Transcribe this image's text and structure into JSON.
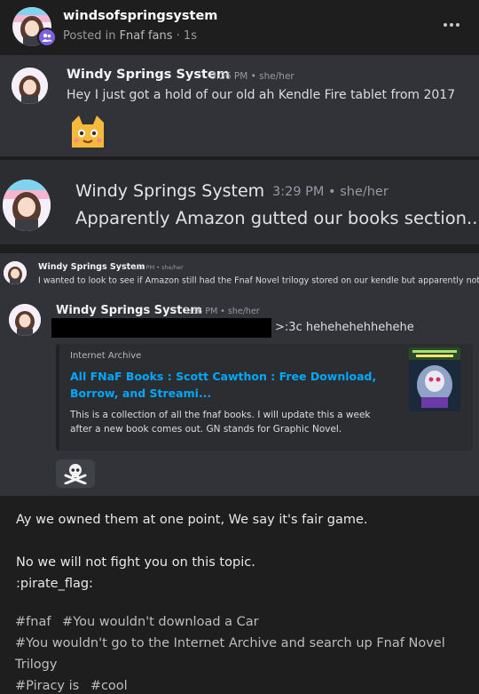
{
  "post": {
    "username": "windsofspringsystem",
    "posted_in_prefix": "Posted in",
    "community": "Fnaf fans",
    "age": "· 1s",
    "more_label": "···"
  },
  "screenshots": [
    {
      "name": "Windy Springs System",
      "time": "3:26 PM • she/her",
      "message": "Hey I just got a hold of our old ah Kendle Fire tablet from 2017"
    },
    {
      "name": "Windy Springs System",
      "time": "3:29 PM • she/her",
      "message": "Apparently Amazon gutted our books section..."
    },
    {
      "name": "Windy Springs System",
      "time": "3:31 PM • she/her",
      "message": "I wanted to look to see if Amazon still had the Fnaf Novel trilogy stored on our kendle but apparently not"
    },
    {
      "name": "Windy Springs System",
      "time": "3:36 PM • she/her",
      "message": ">:3c hehehehehhehehe"
    }
  ],
  "embed": {
    "provider": "Internet Archive",
    "title": "All FNaF Books : Scott Cawthon : Free Download, Borrow, and Streami...",
    "description": "This is a collection of all the fnaf books. I will update this a week after a new book comes out. GN stands for Graphic Novel."
  },
  "caption": {
    "line1": "Ay we owned them at one point, We say it's fair game.",
    "line2": "No we will not fight you on this topic.",
    "line3": ":pirate_flag:"
  },
  "tags": [
    "#fnaf",
    "#You wouldn't download a Car",
    "#You wouldn't go to the Internet Archive and search up Fnaf Novel Trilogy",
    "#Piracy is",
    "#cool"
  ],
  "colors": {
    "background": "#1e1e1e",
    "discord_bg": "#313338",
    "link": "#00a8fc",
    "badge": "#7b61e0"
  },
  "icons": [
    "community-icon",
    "more-options-icon",
    "cat-emoji-icon",
    "skull-crossbones-icon"
  ]
}
